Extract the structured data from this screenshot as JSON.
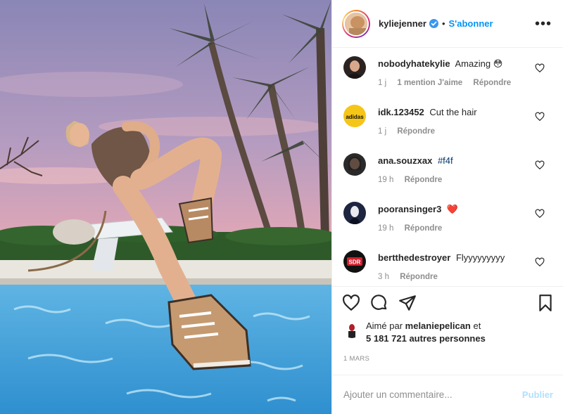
{
  "post": {
    "author": "kyliejenner",
    "separator": "•",
    "follow_label": "S'abonner",
    "more_label": "•••"
  },
  "comments": [
    {
      "user": "nobodyhatekylie",
      "text": "Amazing",
      "emoji": "😳",
      "time": "1 j",
      "likes": "1 mention J'aime",
      "reply": "Répondre"
    },
    {
      "user": "idk.123452",
      "text": "Cut the hair",
      "time": "1 j",
      "reply": "Répondre"
    },
    {
      "user": "ana.souzxax",
      "tag": "#f4f",
      "time": "19 h",
      "reply": "Répondre"
    },
    {
      "user": "pooransinger3",
      "emoji": "❤️",
      "time": "19 h",
      "reply": "Répondre"
    },
    {
      "user": "bertthedestroyer",
      "text": "Flyyyyyyyyy",
      "time": "3 h",
      "reply": "Répondre"
    }
  ],
  "likes": {
    "prefix": "Aimé par",
    "user": "melaniepelican",
    "suffix": "et",
    "count_text": "5 181 721 autres personnes"
  },
  "date": "1 MARS",
  "add_comment": {
    "placeholder": "Ajouter un commentaire...",
    "publish_label": "Publier"
  },
  "icons": {
    "like": "heart-icon",
    "comment": "comment-icon",
    "share": "paper-plane-icon",
    "save": "bookmark-icon",
    "verified": "verified-badge-icon"
  },
  "colors": {
    "link_blue": "#0095f6",
    "muted": "#8e8e8e",
    "publish_disabled": "#b2dffc",
    "text": "#262626"
  }
}
